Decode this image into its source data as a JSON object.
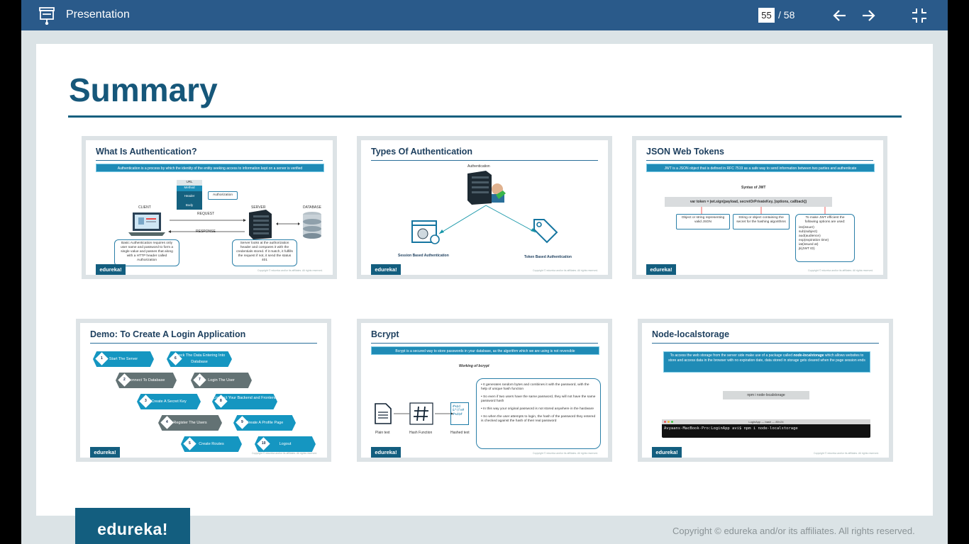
{
  "topbar": {
    "title": "Presentation",
    "current_page": "55",
    "total_pages": "/ 58"
  },
  "slide": {
    "heading": "Summary",
    "thumbnails": [
      {
        "title": "What Is Authentication?",
        "banner": "Authentication is a process by which the identity of the entity seeking access to information kept on a server is verified",
        "labels": [
          "URL",
          "Method",
          "Header",
          "Body",
          "Authorization",
          "CLIENT",
          "SERVER",
          "DATABASE",
          "REQUEST",
          "RESPONSE"
        ],
        "notes": [
          "Basic Authentication requires only user name and password to form a single value and passes that along with a HTTP header called Authorization",
          "Server looks at the authorization header and compares it with the credentials stored. If it match, it fulfills the request if not, it send the status 401"
        ]
      },
      {
        "title": "Types Of Authentication",
        "labels": [
          "Authentication",
          "Session Based Authentication",
          "Token Based Authentication"
        ]
      },
      {
        "title": "JSON Web Tokens",
        "banner": "JWT is a JSON object that is defined in RFC 7519 as a safe way to send information between two parties and authenticate",
        "syntax_title": "Syntax of JWT",
        "syntax": "var token = jwt.sign(payload, secretOrPrivateKey, [options, callback])",
        "notes": [
          "Object or string representing valid JSON",
          "String or object containing the secret for the hashing algorithms",
          "To make JWT efficient the following options are used:"
        ],
        "options": [
          "iss(issuer)",
          "sub(subject)",
          "aud(audience)",
          "exp(expiration time)",
          "iat(issued at)",
          "jti(JWT ID)"
        ]
      },
      {
        "title": "Demo: To Create A Login Application",
        "steps": [
          {
            "n": "1",
            "label": "Start The Server"
          },
          {
            "n": "2",
            "label": "Connect To Database"
          },
          {
            "n": "3",
            "label": "Create A Secret Key"
          },
          {
            "n": "4",
            "label": "Register The Users"
          },
          {
            "n": "5",
            "label": "Create Routes"
          },
          {
            "n": "6",
            "label": "Check The Data Entering Into Database"
          },
          {
            "n": "7",
            "label": "Login The User"
          },
          {
            "n": "8",
            "label": "Connect Your Backend and Frontend"
          },
          {
            "n": "9",
            "label": "Create A Profile Page"
          },
          {
            "n": "10",
            "label": "Logout"
          }
        ]
      },
      {
        "title": "Bcrypt",
        "banner": "Bcrypt is a secured way to store passwords in your database, as the algorithm which we are using is not reversible",
        "subtitle": "Working of bcrypt",
        "labels": [
          "Plain text",
          "Hash Function",
          "Hashed text"
        ],
        "bullets": [
          "It generates random bytes and combines it with the password, with the help of unique hash function",
          "So even if two users have the same password, they will not have the same password hash",
          "In this way your original password is not stored anywhere in the hardware",
          "So when the user attempts to login, the hash of the password they entered is checked against the hash of their real password"
        ]
      },
      {
        "title": "Node-localstorage",
        "banner_parts": [
          "To access the web storage from the server side make use of a package called ",
          "node-localstorage",
          " which allows websites to store and access data in the browser with no expiration date, data stored in storage gets cleared when the page session ends"
        ],
        "command": "npm i node-localstorage",
        "terminal_title": "LoginApp — bash — 80×24",
        "terminal_line": "Avyaans-MacBook-Pro:LoginApp avi$ npm i node-localstorage"
      }
    ],
    "thumb_footer": "edureka!",
    "thumb_copyright": "Copyright © edureka and/or its affiliates. All rights reserved."
  },
  "footer": {
    "logo": "edureka!",
    "copyright": "Copyright © edureka and/or its affiliates. All rights reserved."
  }
}
